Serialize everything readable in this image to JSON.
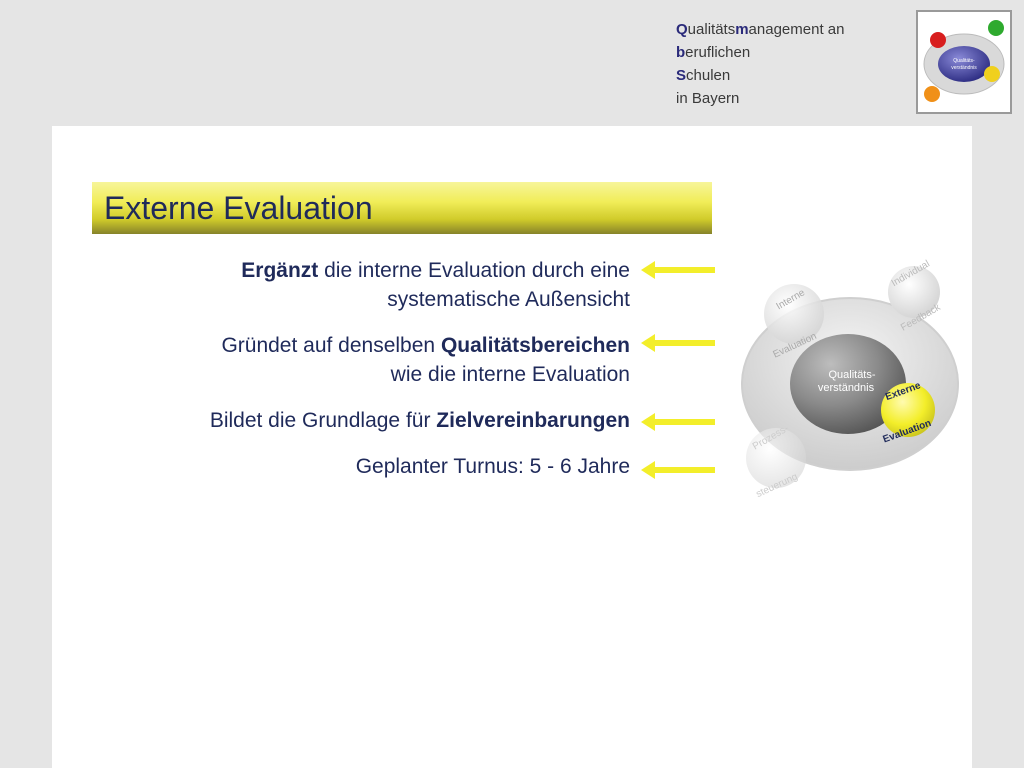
{
  "header": {
    "lines": [
      {
        "accent": "Q",
        "rest": "ualitäts",
        "accent2": "m",
        "rest2": "anagement an"
      },
      {
        "accent": "b",
        "rest": "eruflichen"
      },
      {
        "accent": "S",
        "rest": "chulen"
      },
      {
        "accent": "",
        "rest": "in Bayern"
      }
    ]
  },
  "logo": {
    "center": "Qualitäts-\nverständnis",
    "labels": [
      "Interne",
      "Evaluation",
      "Individual",
      "Feedback",
      "Externe",
      "Evaluation",
      "Prozess-",
      "steuerung"
    ]
  },
  "slide": {
    "title": "Externe Evaluation",
    "bullets": [
      {
        "line1_bold": "Ergänzt",
        "line1_rest": " die interne Evaluation durch eine",
        "line2": "systematische Außensicht"
      },
      {
        "line1_pre": "Gründet auf denselben ",
        "line1_bold": "Qualitätsbereichen",
        "line2": "wie die interne Evaluation"
      },
      {
        "line1_pre": "Bildet die Grundlage für ",
        "line1_bold": "Zielvereinbarungen"
      },
      {
        "line1_pre": "Geplanter Turnus: 5 - 6 Jahre"
      }
    ]
  },
  "diagram": {
    "center_line1": "Qualitäts-",
    "center_line2": "verständnis",
    "interne": "Interne",
    "interne_eval": "Evaluation",
    "individual": "Individual",
    "feedback": "Feedback",
    "externe": "Externe",
    "externe_eval": "Evaluation",
    "prozess": "Prozess-",
    "steuerung": "steuerung"
  },
  "colors": {
    "arrow": "#f3ee2a",
    "title_text": "#1f2a5a",
    "header_accent": "#2a2a7a"
  }
}
